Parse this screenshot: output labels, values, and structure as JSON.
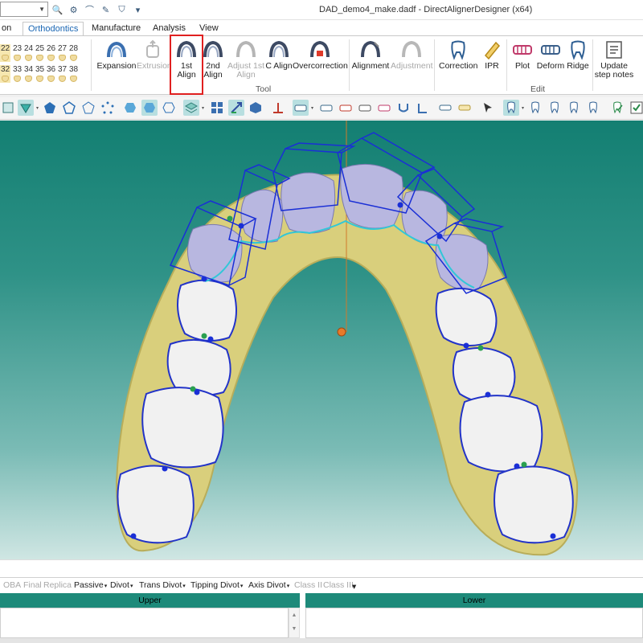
{
  "window": {
    "title": "DAD_demo4_make.dadf - DirectAlignerDesigner (x64)"
  },
  "tabs": [
    "on",
    "Orthodontics",
    "Manufacture",
    "Analysis",
    "View"
  ],
  "active_tab": "Orthodontics",
  "tooth_grid": {
    "row1": [
      "22",
      "23",
      "24",
      "25",
      "26",
      "27",
      "28"
    ],
    "row2": [
      "32",
      "33",
      "34",
      "35",
      "36",
      "37",
      "38"
    ]
  },
  "ribbon": {
    "expansion": "Expansion",
    "extrusion": "Extrusion",
    "first_align": "1st Align",
    "second_align": "2nd Align",
    "adjust_first_align": "Adjust 1st Align",
    "c_align": "C Align",
    "overcorrection": "Overcorrection",
    "alignment": "Alignment",
    "adjustment": "Adjustment",
    "correction": "Correction",
    "ipr": "IPR",
    "plot": "Plot",
    "deform": "Deform",
    "ridge": "Ridge",
    "update_step_notes": "Update step notes",
    "group_tool": "Tool",
    "group_edit": "Edit"
  },
  "bottom_bar": {
    "oba": "OBA",
    "final": "Final",
    "replica": "Replica",
    "passive": "Passive",
    "divot": "Divot",
    "trans_divot": "Trans Divot",
    "tipping_divot": "Tipping Divot",
    "axis_divot": "Axis Divot",
    "class_ii": "Class II",
    "class_iii": "Class III"
  },
  "panels": {
    "upper": "Upper",
    "lower": "Lower"
  },
  "colors": {
    "accent_tab": "#1a66b3",
    "highlight_box": "#e02020",
    "viewport_top": "#137f72",
    "panel_header": "#1e8a7a",
    "gum": "#d9cf7c",
    "bracket_box": "#1a2fd6"
  },
  "icons": [
    "dropdown-icon",
    "search-icon",
    "gear-icon",
    "arch-icon",
    "pencil-icon",
    "tooth-icon"
  ]
}
